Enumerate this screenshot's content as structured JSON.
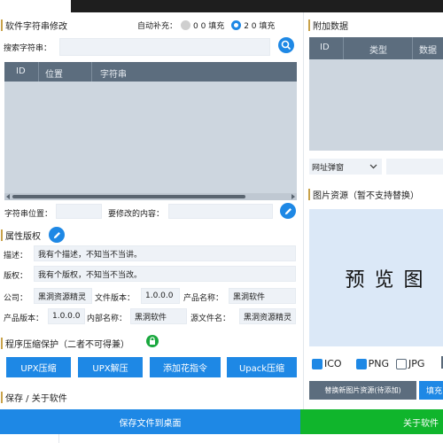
{
  "left": {
    "strings_section": {
      "title": "软件字符串修改",
      "auto_fill_label": "自动补充：",
      "option_00": "0 0 填充",
      "option_20": "2 0 填充",
      "search_label": "搜索字符串：",
      "columns": [
        "ID",
        "位置",
        "字符串"
      ],
      "position_label": "字符串位置：",
      "edit_content_label": "要修改的内容："
    },
    "props_section": {
      "title": "属性版权",
      "desc_label": "描述：",
      "desc_value": "我有个描述，不知当不当讲。",
      "copyright_label": "版权：",
      "copyright_value": "我有个版权，不知当不当改。",
      "company_label": "公司：",
      "company_value": "黑洞资源精灵",
      "file_version_label": "文件版本：",
      "file_version_value": "1.0.0.0",
      "product_name_label": "产品名称：",
      "product_name_value": "黑洞软件",
      "product_version_label": "产品版本：",
      "product_version_value": "1.0.0.0",
      "internal_name_label": "内部名称：",
      "internal_name_value": "黑洞软件",
      "source_file_label": "源文件名：",
      "source_file_value": "黑洞资源精灵"
    },
    "compress_section": {
      "title": "程序压缩保护（二者不可得兼）",
      "buttons": [
        "UPX压缩",
        "UPX解压",
        "添加花指令",
        "Upack压缩"
      ]
    },
    "save_section": {
      "title": "保存 / 关于软件"
    }
  },
  "right": {
    "extra_section": {
      "title": "附加数据",
      "columns": [
        "ID",
        "类型",
        "数据"
      ],
      "dropdown_value": "网址弹窗"
    },
    "image_section": {
      "title": "图片资源（暂不支持替换）",
      "preview_text": "预 览 图",
      "formats": [
        {
          "label": "ICO",
          "checked": true
        },
        {
          "label": "PNG",
          "checked": true
        },
        {
          "label": "JPG",
          "checked": false
        }
      ],
      "replace_button": "替换新图片资源(待添加)",
      "fill_button": "填充"
    }
  },
  "footer": {
    "save_button": "保存文件到桌面",
    "about_button": "关于软件"
  },
  "colors": {
    "accent_blue": "#1e88e5",
    "footer_green": "#10b52c",
    "grid_header": "#5c6d7e",
    "grid_body": "#cdd6df",
    "preview_bg": "#dbe8f7",
    "section_marker": "#c8a24a"
  }
}
